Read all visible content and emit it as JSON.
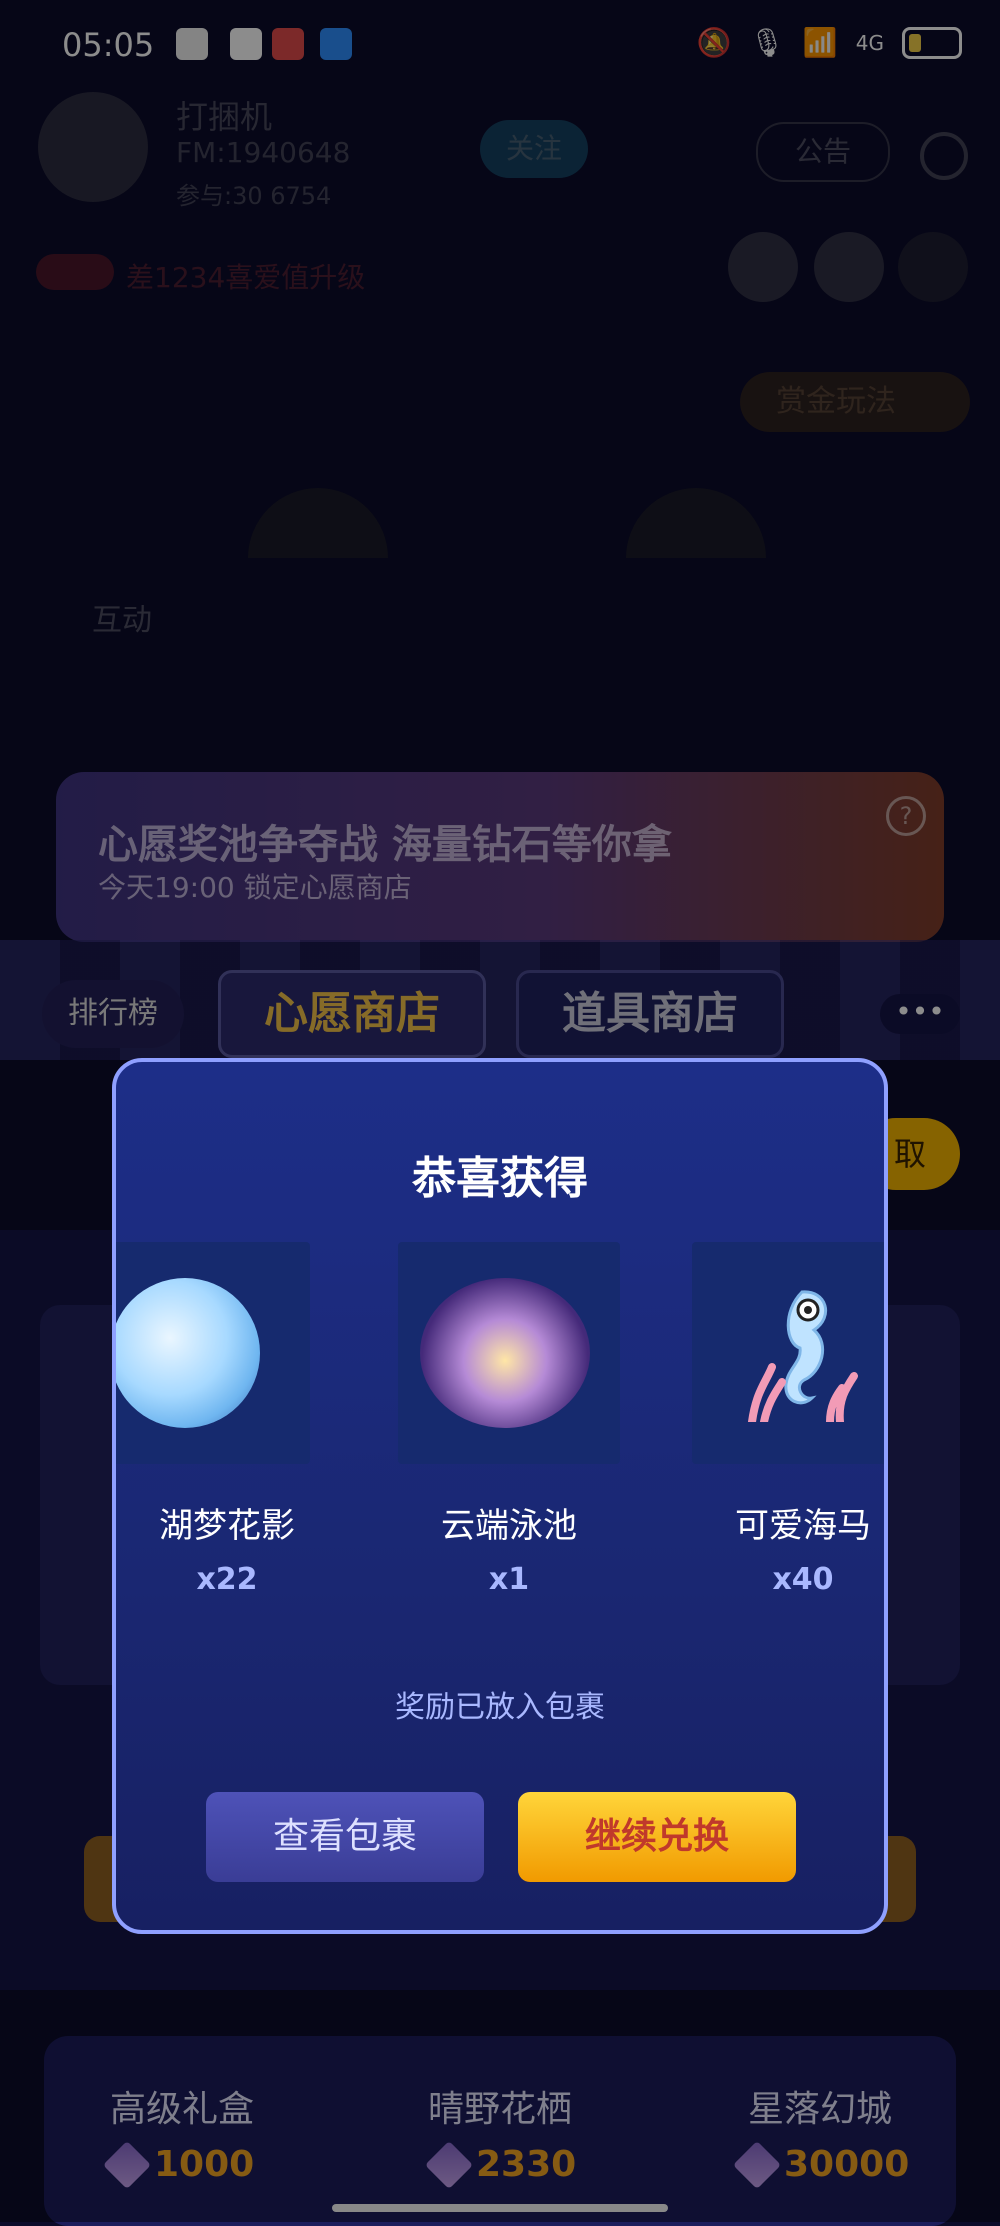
{
  "status_bar": {
    "time": "05:05",
    "network": "4G"
  },
  "background": {
    "room_name": "打捆机",
    "room_id": "FM:1940648",
    "room_stats": "参与:30  6754",
    "follow_label": "关注",
    "notice_label": "公告",
    "level_text": "差1234喜爱值升级",
    "gold_label": "赏金玩法",
    "interact_label": "互动",
    "banner_title": "心愿奖池争夺战 海量钻石等你拿",
    "banner_subtitle": "今天19:00 锁定心愿商店",
    "rank_tab": "排行榜",
    "shop_tabs": [
      "心愿商店",
      "道具商店"
    ],
    "more_label": "•••",
    "claim_label": "取"
  },
  "modal": {
    "title": "恭喜获得",
    "rewards": [
      {
        "name": "湖梦花影",
        "qty": "x22"
      },
      {
        "name": "云端泳池",
        "qty": "x1"
      },
      {
        "name": "可爱海马",
        "qty": "x40"
      }
    ],
    "notice": "奖励已放入包裹",
    "view_button": "查看包裹",
    "continue_button": "继续兑换"
  },
  "bottom_items": [
    {
      "name": "高级礼盒",
      "price": "1000"
    },
    {
      "name": "晴野花栖",
      "price": "2330"
    },
    {
      "name": "星落幻城",
      "price": "30000"
    }
  ],
  "colors": {
    "accent_gold": "#f5a623",
    "modal_border": "#8fa0ff",
    "continue_red": "#c0392b"
  }
}
